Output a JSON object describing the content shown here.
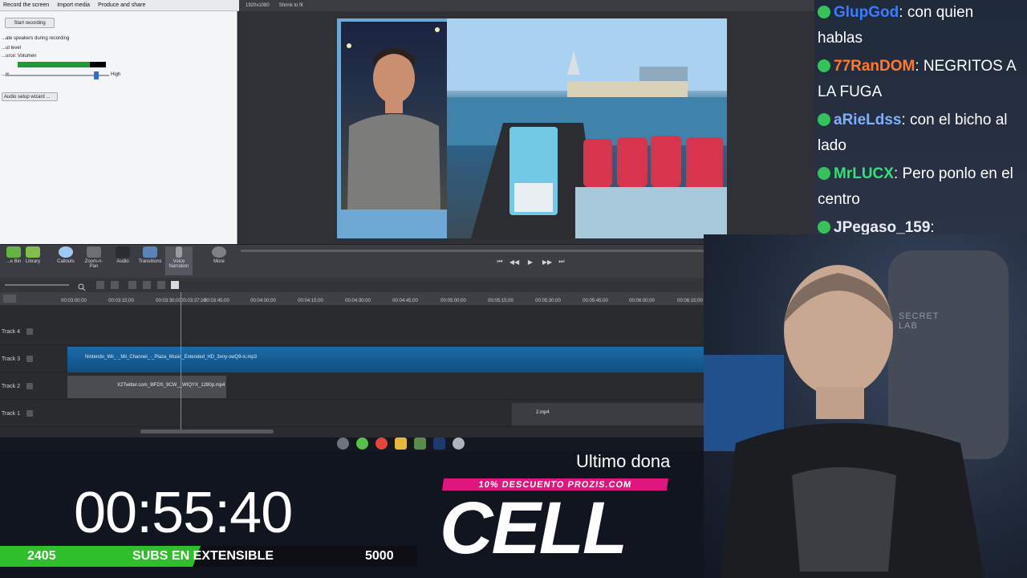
{
  "menu": {
    "record": "Record the screen",
    "import": "Import media",
    "produce": "Produce and share"
  },
  "record_panel": {
    "start_button": "Start recording",
    "speakers_option": "...ate speakers during recording",
    "input_level": "...ut level",
    "source_label": "...urce:",
    "source_value": "Volumen",
    "low_label": "...w",
    "high_label": "High",
    "audio_wizard_button": "Audio setup wizard ...",
    "level_percent": 0.82,
    "volume_percent": 0.85
  },
  "preview_toolbar": {
    "resolution": "1920x1080",
    "fit": "Shrink to fit"
  },
  "tools": [
    {
      "label": "...e Bin"
    },
    {
      "label": "Library"
    },
    {
      "label": "Callouts"
    },
    {
      "label": "Zoom-n-\nPan"
    },
    {
      "label": "Audio"
    },
    {
      "label": "Transitions"
    },
    {
      "label": "Voice\nNarration"
    },
    {
      "label": "More"
    }
  ],
  "ruler": [
    "00:03:00;00",
    "00:03:15;00",
    "00:03:30;00",
    "00:03:37;10",
    "00:03:45;00",
    "00:04:00;00",
    "00:04:15;00",
    "00:04:30;00",
    "00:04:45;00",
    "00:05:00;00",
    "00:05:15;00",
    "00:05:30;00",
    "00:05:45;00",
    "00:06:00;00",
    "00:06:15;00"
  ],
  "tracks": [
    {
      "name": "Track 4"
    },
    {
      "name": "Track 3",
      "clip": "Nintendo_Wii_-_Mii_Channel_-_Plaza_Music_Extended_HD_3xny-swQ9-ic.mp3"
    },
    {
      "name": "Track 2",
      "clip": "X2Twitter.com_9lFDS_9CW__WIQYX_1280p.mp4"
    },
    {
      "name": "Track 1",
      "clip": "2.mp4"
    }
  ],
  "chat": [
    {
      "user": "GlupGod",
      "color": "#3b7cff",
      "text": ": con quien hablas"
    },
    {
      "user": "77RanDOM",
      "color": "#ff7a2e",
      "text": ": NEGRITOS A LA FUGA"
    },
    {
      "user": "aRieLdss",
      "color": "#7fb0ff",
      "text": ": con el bicho al lado"
    },
    {
      "user": "MrLUCX",
      "color": "#35e07a",
      "text": ": Pero ponlo en el centro"
    },
    {
      "user": "JPegaso_159",
      "color": "#e9eef6",
      "text": ":"
    }
  ],
  "webcam_wall_text": "SECRET\nLAB",
  "overlay": {
    "timer": "00:55:40",
    "subs_current": "2405",
    "subs_label": "SUBS EN EXTENSIBLE",
    "subs_goal": "5000",
    "ultimo": "Ultimo dona",
    "promo": "10% DESCUENTO PROZIS.COM",
    "cell": "CELL"
  },
  "colors": {
    "accent_green": "#2fbf2a",
    "promo_pink": "#e0157d"
  }
}
